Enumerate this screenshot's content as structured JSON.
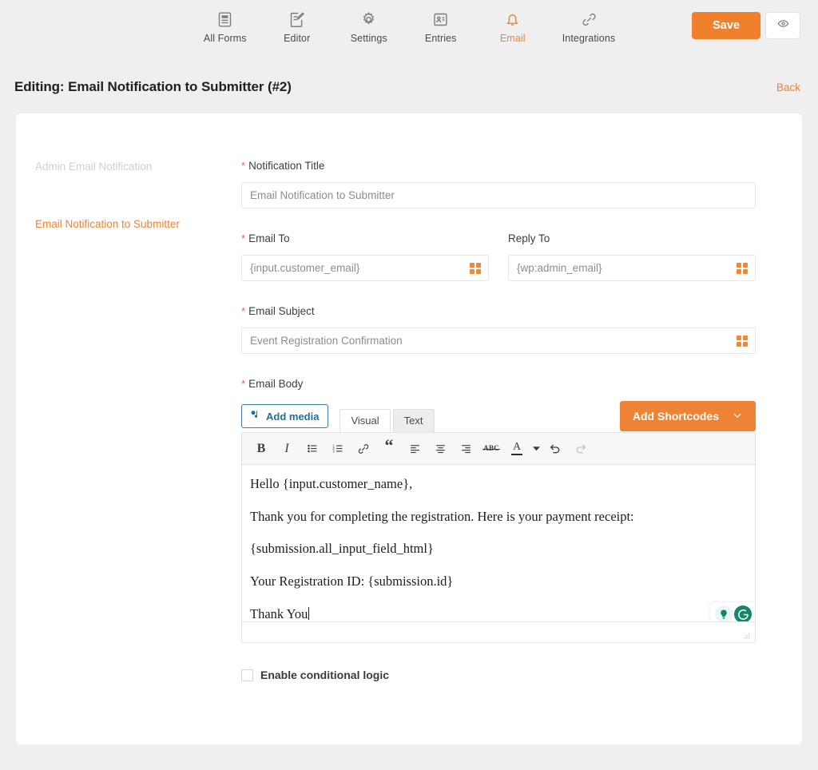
{
  "topnav": {
    "items": [
      {
        "label": "All Forms",
        "icon": "forms-icon",
        "active": false
      },
      {
        "label": "Editor",
        "icon": "editor-pencil-icon",
        "active": false
      },
      {
        "label": "Settings",
        "icon": "gear-icon",
        "active": false
      },
      {
        "label": "Entries",
        "icon": "entries-card-icon",
        "active": false
      },
      {
        "label": "Email",
        "icon": "bell-icon",
        "active": true
      },
      {
        "label": "Integrations",
        "icon": "link-icon",
        "active": false
      }
    ],
    "save_label": "Save",
    "preview_icon": "eye-icon",
    "accent_color": "#ef8335",
    "save_color": "#f1802d"
  },
  "page": {
    "title": "Editing: Email Notification to Submitter (#2)",
    "back_label": "Back"
  },
  "sidebar": {
    "items": [
      {
        "label": "Admin Email Notification",
        "state": "muted"
      },
      {
        "label": "Email Notification to Submitter",
        "state": "active"
      }
    ]
  },
  "form": {
    "notification_title": {
      "label": "Notification Title",
      "required": true,
      "value": "",
      "placeholder": "Email Notification to Submitter"
    },
    "email_to": {
      "label": "Email To",
      "required": true,
      "value": "",
      "placeholder": "{input.customer_email}",
      "shortcode_icon": "shortcode-grid-icon"
    },
    "reply_to": {
      "label": "Reply To",
      "required": false,
      "value": "",
      "placeholder": "{wp:admin_email}",
      "shortcode_icon": "shortcode-grid-icon"
    },
    "email_subject": {
      "label": "Email Subject",
      "required": true,
      "value": "",
      "placeholder": "Event Registration Confirmation",
      "shortcode_icon": "shortcode-grid-icon"
    },
    "email_body": {
      "label": "Email Body",
      "required": true,
      "add_media_label": "Add media",
      "add_media_icon": "media-icon",
      "tab_visual": "Visual",
      "tab_text": "Text",
      "active_tab": "Visual",
      "add_shortcodes_label": "Add Shortcodes",
      "add_shortcodes_caret": "chevron-down-icon",
      "toolbar": [
        {
          "name": "bold-icon",
          "glyph": "B",
          "disabled": false
        },
        {
          "name": "italic-icon",
          "glyph": "I",
          "disabled": false
        },
        {
          "name": "bullet-list-icon",
          "glyph": "",
          "disabled": false
        },
        {
          "name": "numbered-list-icon",
          "glyph": "",
          "disabled": false
        },
        {
          "name": "link-icon",
          "glyph": "",
          "disabled": false
        },
        {
          "name": "blockquote-icon",
          "glyph": "“",
          "disabled": false
        },
        {
          "name": "align-left-icon",
          "glyph": "",
          "disabled": false
        },
        {
          "name": "align-center-icon",
          "glyph": "",
          "disabled": false
        },
        {
          "name": "align-right-icon",
          "glyph": "",
          "disabled": false
        },
        {
          "name": "strikethrough-icon",
          "glyph": "ABC",
          "disabled": false
        },
        {
          "name": "text-color-icon",
          "glyph": "A",
          "disabled": false
        },
        {
          "name": "undo-icon",
          "glyph": "",
          "disabled": false
        },
        {
          "name": "redo-icon",
          "glyph": "",
          "disabled": true
        }
      ],
      "content_lines": [
        "Hello {input.customer_name},",
        "Thank you for completing the registration. Here is your payment receipt:",
        "{submission.all_input_field_html}",
        "Your Registration ID: {submission.id}",
        "Thank You"
      ],
      "cursor_after_last_line": true,
      "grammarly": {
        "bulb_icon": "lightbulb-icon",
        "logo_icon": "grammarly-g-icon",
        "color": "#14876b"
      },
      "resize_handle_icon": "resize-handle-icon"
    },
    "conditional_logic": {
      "label": "Enable conditional logic",
      "checked": false
    }
  }
}
